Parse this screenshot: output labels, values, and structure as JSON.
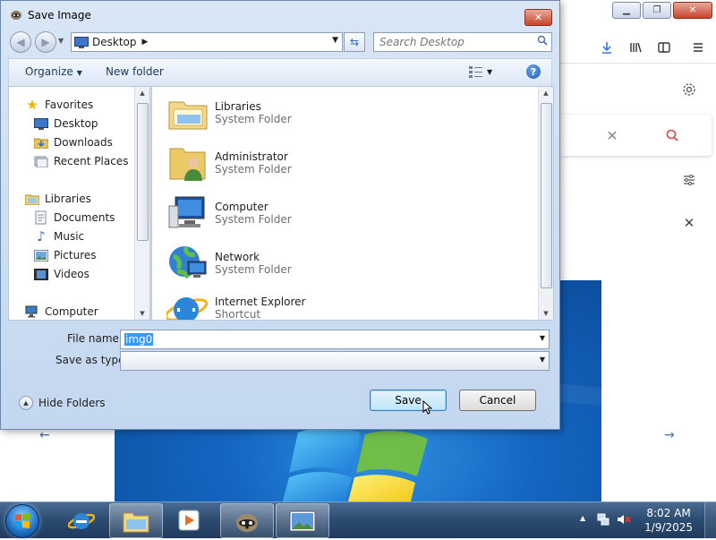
{
  "dialog": {
    "title": "Save Image",
    "address": {
      "location": "Desktop"
    },
    "search": {
      "placeholder": "Search Desktop"
    },
    "toolbar": {
      "organize": "Organize",
      "new_folder": "New folder"
    },
    "nav_pane": {
      "items": [
        {
          "label": "Favorites",
          "icon": "star-icon"
        },
        {
          "label": "Desktop",
          "icon": "desktop-icon"
        },
        {
          "label": "Downloads",
          "icon": "downloads-icon"
        },
        {
          "label": "Recent Places",
          "icon": "recent-places-icon"
        },
        {
          "label": "Libraries",
          "icon": "libraries-icon"
        },
        {
          "label": "Documents",
          "icon": "documents-icon"
        },
        {
          "label": "Music",
          "icon": "music-icon"
        },
        {
          "label": "Pictures",
          "icon": "pictures-icon"
        },
        {
          "label": "Videos",
          "icon": "videos-icon"
        },
        {
          "label": "Computer",
          "icon": "computer-icon"
        }
      ]
    },
    "files": [
      {
        "name": "Libraries",
        "type": "System Folder",
        "icon": "libraries-folder-icon"
      },
      {
        "name": "Administrator",
        "type": "System Folder",
        "icon": "user-folder-icon"
      },
      {
        "name": "Computer",
        "type": "System Folder",
        "icon": "computer-icon"
      },
      {
        "name": "Network",
        "type": "System Folder",
        "icon": "network-icon"
      },
      {
        "name": "Internet Explorer",
        "type": "Shortcut",
        "icon": "internet-explorer-icon"
      }
    ],
    "form": {
      "file_name_label": "File name:",
      "file_name_value": "img0",
      "save_as_type_label": "Save as type:",
      "save_as_type_value": ""
    },
    "hide_folders": "Hide Folders",
    "save_button": "Save",
    "cancel_button": "Cancel"
  },
  "taskbar": {
    "time": "8:02 AM",
    "date": "1/9/2025"
  },
  "colors": {
    "accent": "#3399ff",
    "dialog_frame": "#c3d7ef",
    "taskbar": "#2e4d73"
  }
}
